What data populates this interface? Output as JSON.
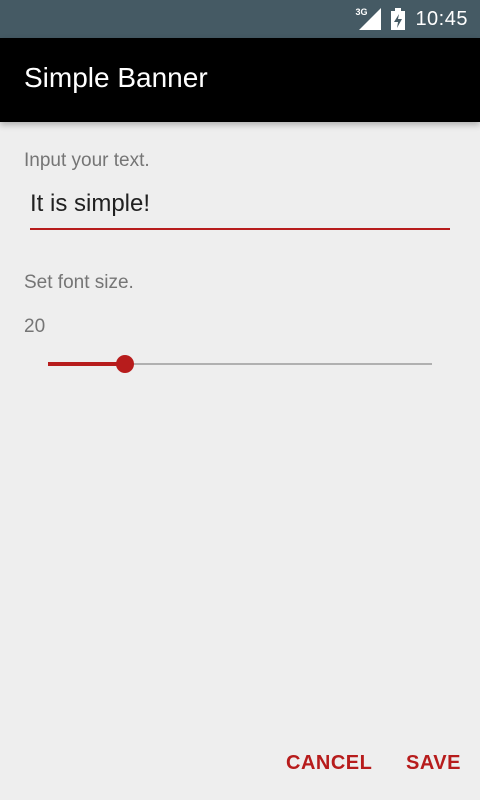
{
  "status_bar": {
    "network_label": "3G",
    "time": "10:45",
    "icons": [
      "cellular-signal-icon",
      "battery-charging-icon"
    ]
  },
  "app_bar": {
    "title": "Simple Banner"
  },
  "form": {
    "text_label": "Input your text.",
    "text_value": "It is simple!",
    "font_size_label": "Set font size.",
    "font_size_value": "20",
    "slider_fraction": 0.2
  },
  "actions": {
    "cancel_label": "CANCEL",
    "save_label": "SAVE"
  },
  "colors": {
    "status_bar": "#455a64",
    "app_bar": "#000000",
    "accent": "#b71c1c",
    "background": "#eeeeee",
    "label_text": "#757575",
    "input_text": "#212121"
  }
}
